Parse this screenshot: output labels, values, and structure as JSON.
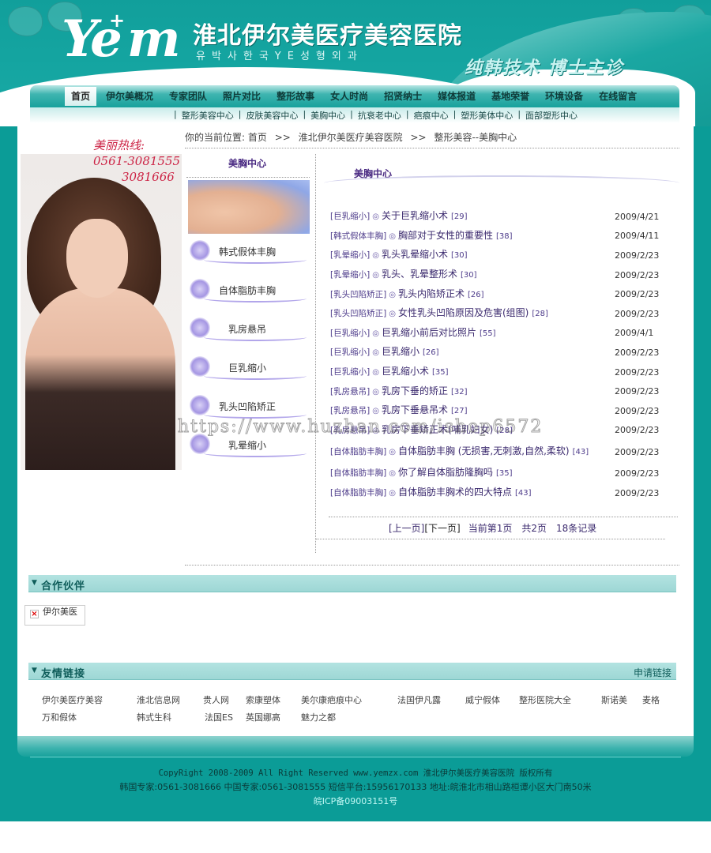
{
  "header": {
    "logo_text": "Ye",
    "logo_text2": "m",
    "logo_plus": "+",
    "site_name": "淮北伊尔美医疗美容医院",
    "site_subtitle": "유박사한국YE성형외과",
    "slogan": "纯韩技术   博士主诊"
  },
  "nav": {
    "items": [
      {
        "label": "首页",
        "active": true
      },
      {
        "label": "伊尔美概况"
      },
      {
        "label": "专家团队"
      },
      {
        "label": "照片对比"
      },
      {
        "label": "整形故事"
      },
      {
        "label": "女人时尚"
      },
      {
        "label": "招贤纳士"
      },
      {
        "label": "媒体报道"
      },
      {
        "label": "基地荣誉"
      },
      {
        "label": "环境设备"
      },
      {
        "label": "在线留言"
      }
    ],
    "subnav": [
      "整形美容中心",
      "皮肤美容中心",
      "美胸中心",
      "抗衰老中心",
      "疤痕中心",
      "塑形美体中心",
      "面部塑形中心"
    ],
    "separator": "|"
  },
  "hotline": {
    "label": "美丽热线:",
    "phone1": "0561-3081555",
    "phone2": "3081666"
  },
  "breadcrumb": {
    "prefix": "你的当前位置:",
    "items": [
      "首页",
      "淮北伊尔美医疗美容医院",
      "整形美容--美胸中心"
    ],
    "separator": ">>"
  },
  "submenu": {
    "title": "美胸中心",
    "items": [
      "韩式假体丰胸",
      "自体脂肪丰胸",
      "乳房悬吊",
      "巨乳缩小",
      "乳头凹陷矫正",
      "乳晕缩小"
    ]
  },
  "list": {
    "title": "美胸中心",
    "bullet": "◎",
    "articles": [
      {
        "category": "[巨乳缩小]",
        "title": "关于巨乳缩小术",
        "hits": "[29]",
        "date": "2009/4/21"
      },
      {
        "category": "[韩式假体丰胸]",
        "title": "胸部对于女性的重要性",
        "hits": "[38]",
        "date": "2009/4/11"
      },
      {
        "category": "[乳晕缩小]",
        "title": "乳头乳晕缩小术",
        "hits": "[30]",
        "date": "2009/2/23"
      },
      {
        "category": "[乳晕缩小]",
        "title": "乳头、乳晕整形术",
        "hits": "[30]",
        "date": "2009/2/23"
      },
      {
        "category": "[乳头凹陷矫正]",
        "title": "乳头内陷矫正术",
        "hits": "[26]",
        "date": "2009/2/23"
      },
      {
        "category": "[乳头凹陷矫正]",
        "title": "女性乳头凹陷原因及危害(组图)",
        "hits": "[28]",
        "date": "2009/2/23"
      },
      {
        "category": "[巨乳缩小]",
        "title": "巨乳缩小前后对比照片",
        "hits": "[55]",
        "date": "2009/4/1"
      },
      {
        "category": "[巨乳缩小]",
        "title": "巨乳缩小",
        "hits": "[26]",
        "date": "2009/2/23"
      },
      {
        "category": "[巨乳缩小]",
        "title": "巨乳缩小术",
        "hits": "[35]",
        "date": "2009/2/23"
      },
      {
        "category": "[乳房悬吊]",
        "title": "乳房下垂的矫正",
        "hits": "[32]",
        "date": "2009/2/23"
      },
      {
        "category": "[乳房悬吊]",
        "title": "乳房下垂悬吊术",
        "hits": "[27]",
        "date": "2009/2/23"
      },
      {
        "category": "[乳房悬吊]",
        "title": "乳房下垂矫正术(哺乳妇女)",
        "hits": "[28]",
        "date": "2009/2/23"
      },
      {
        "category": "[自体脂肪丰胸]",
        "title": "自体脂肪丰胸 (无损害,无刺激,自然,柔软)",
        "hits": "[43]",
        "date": "2009/2/23"
      },
      {
        "category": "[自体脂肪丰胸]",
        "title": "你了解自体脂肪隆胸吗",
        "hits": "[35]",
        "date": "2009/2/23"
      },
      {
        "category": "[自体脂肪丰胸]",
        "title": "自体脂肪丰胸术的四大特点",
        "hits": "[43]",
        "date": "2009/2/23"
      }
    ]
  },
  "pager": {
    "prev": "[上一页]",
    "next": "[下一页]",
    "current": "当前第1页",
    "total_pages": "共2页",
    "total_records": "18条记录"
  },
  "watermark": "https://www.huzhan.com/ishop6572",
  "partners": {
    "title": "合作伙伴",
    "items": [
      {
        "label": "伊尔美医",
        "broken_image": true
      }
    ]
  },
  "friend_links": {
    "title": "友情链接",
    "apply_label": "申请链接",
    "rows": [
      [
        "伊尔美医疗美容",
        "淮北信息网",
        "贵人网",
        "索康塑体",
        "美尔康疤痕中心",
        "法国伊凡露",
        "威宁假体",
        "整形医院大全",
        "斯诺美",
        "麦格"
      ],
      [
        "万和假体",
        "韩式生科",
        "法国ES",
        "英国娜高",
        "魅力之都"
      ]
    ]
  },
  "footer": {
    "copyright": "CopyRight 2008-2009 All Right Reserved www.yemzx.com 淮北伊尔美医疗美容医院 版权所有",
    "contact": "韩国专家:0561-3081666 中国专家:0561-3081555 短信平台:15956170133 地址:皖淮北市相山路桓谭小区大门南50米",
    "icp": "皖ICP备09003151号"
  },
  "colors": {
    "brand_teal": "#0b9c97",
    "link_purple": "#3b2a6e",
    "hotline_red": "#cc2244"
  }
}
